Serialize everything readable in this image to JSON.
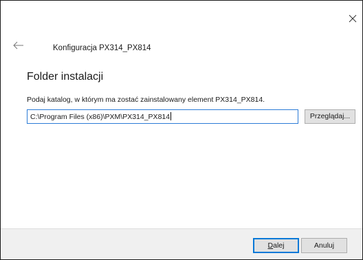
{
  "window": {
    "title": "Konfiguracja PX314_PX814"
  },
  "page": {
    "heading": "Folder instalacji",
    "instruction": "Podaj katalog, w którym ma zostać zainstalowany element PX314_PX814."
  },
  "path_field": {
    "value": "C:\\Program Files (x86)\\PXM\\PX314_PX814"
  },
  "buttons": {
    "browse_label": "Przeglądaj...",
    "next_label": "Dalej",
    "cancel_label": "Anuluj"
  },
  "icons": {
    "close": "close-icon",
    "back": "back-arrow-icon"
  }
}
